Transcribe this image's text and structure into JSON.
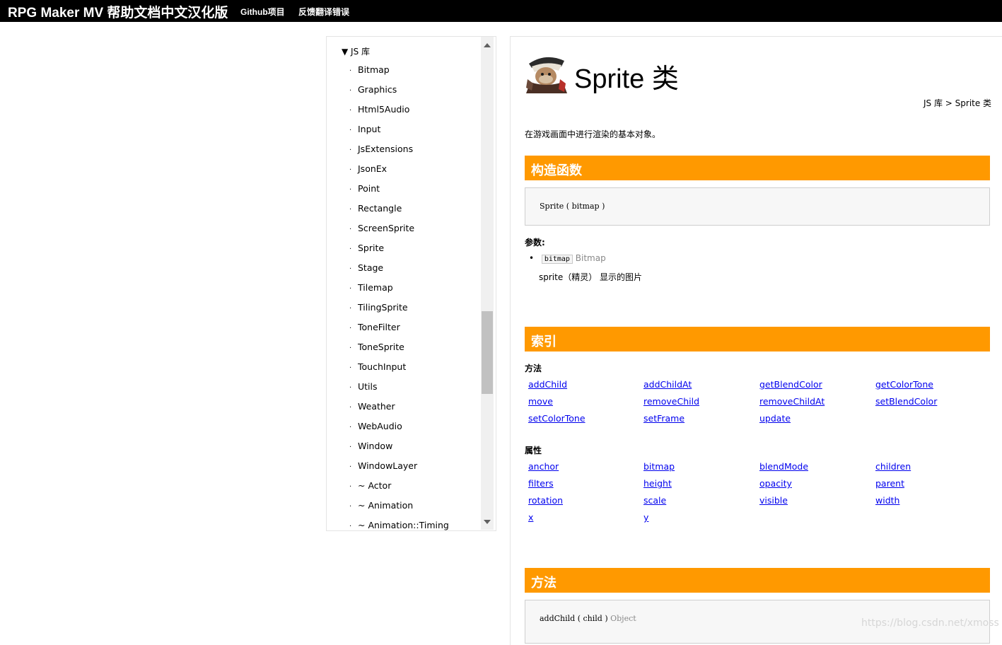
{
  "topbar": {
    "brand": "RPG Maker MV 帮助文档中文汉化版",
    "nav_github": "Github项目",
    "nav_feedback": "反馈翻译错误"
  },
  "sidebar": {
    "root_label": "▼ JS 库",
    "items": [
      "Bitmap",
      "Graphics",
      "Html5Audio",
      "Input",
      "JsExtensions",
      "JsonEx",
      "Point",
      "Rectangle",
      "ScreenSprite",
      "Sprite",
      "Stage",
      "Tilemap",
      "TilingSprite",
      "ToneFilter",
      "ToneSprite",
      "TouchInput",
      "Utils",
      "Weather",
      "WebAudio",
      "Window",
      "WindowLayer",
      "~ Actor",
      "~ Animation",
      "~ Animation::Timing"
    ]
  },
  "page": {
    "title": "Sprite 类",
    "breadcrumb": "JS 库 > Sprite 类",
    "description": "在游戏画面中进行渲染的基本对象。"
  },
  "constructor": {
    "heading": "构造函数",
    "signature": "Sprite ( bitmap )",
    "params_label": "参数:",
    "param_name": "bitmap",
    "param_type": "Bitmap",
    "param_desc": "sprite（精灵） 显示的图片"
  },
  "index": {
    "heading": "索引",
    "methods_label": "方法",
    "methods": [
      "addChild",
      "addChildAt",
      "getBlendColor",
      "getColorTone",
      "move",
      "removeChild",
      "removeChildAt",
      "setBlendColor",
      "setColorTone",
      "setFrame",
      "update"
    ],
    "properties_label": "属性",
    "properties": [
      "anchor",
      "bitmap",
      "blendMode",
      "children",
      "filters",
      "height",
      "opacity",
      "parent",
      "rotation",
      "scale",
      "visible",
      "width",
      "x",
      "y"
    ]
  },
  "methods_section": {
    "heading": "方法",
    "first_signature": "addChild ( child )",
    "first_return": "Object"
  },
  "watermark": "https://blog.csdn.net/xmoss"
}
